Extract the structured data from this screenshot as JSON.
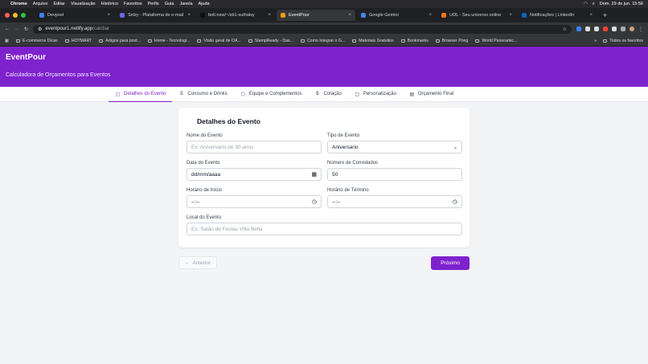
{
  "os_menu": {
    "items": [
      "Chrome",
      "Arquivo",
      "Editar",
      "Visualização",
      "Histórico",
      "Favoritos",
      "Perfis",
      "Guia",
      "Janela",
      "Ajuda"
    ],
    "clock": "Dom. 29 de jun.  15:56"
  },
  "tabs": [
    {
      "label": "Devpost",
      "active": false,
      "color": "#3b82f6"
    },
    {
      "label": "Selzy - Plataforma de e-mail",
      "active": false,
      "color": "#6366f1"
    },
    {
      "label": "bolt.new/~/sb1-suthalsy",
      "active": false,
      "color": "#111111"
    },
    {
      "label": "EventPour",
      "active": true,
      "color": "#f59e0b"
    },
    {
      "label": "Google Gemini",
      "active": false,
      "color": "#4285f4"
    },
    {
      "label": "UOL - Seu universo online",
      "active": false,
      "color": "#f97316"
    },
    {
      "label": "Notificações | LinkedIn",
      "active": false,
      "color": "#0a66c2"
    }
  ],
  "address": {
    "host": "eventpour1.netlify.app",
    "path": "/calcbar"
  },
  "bookmarks": {
    "items": [
      "E-commerce Dicas",
      "HOTMART",
      "Artigos para post...",
      "Home - Tecnologi...",
      "Visão geral de OA...",
      "StampReady - Das...",
      "Como Integrar o G...",
      "Materiais Gratuitos",
      "Bookmarks",
      "Browser Pong",
      "World Panoramic..."
    ],
    "more": "»",
    "all": "Todos os favoritos"
  },
  "app": {
    "title": "EventPour",
    "subtitle": "Calculadora de Orçamentos para Eventos"
  },
  "nav": [
    {
      "label": "Detalhes do Evento",
      "icon": "calendar-icon",
      "glyph": "▢",
      "active": true
    },
    {
      "label": "Consumo e Drinks",
      "icon": "glasses-icon",
      "glyph": "ඹ",
      "active": false
    },
    {
      "label": "Equipe e Complementos",
      "icon": "package-icon",
      "glyph": "⬡",
      "active": false
    },
    {
      "label": "Cotação",
      "icon": "dollar-icon",
      "glyph": "$",
      "active": false
    },
    {
      "label": "Personalização",
      "icon": "palette-icon",
      "glyph": "▢",
      "active": false
    },
    {
      "label": "Orçamento Final",
      "icon": "file-icon",
      "glyph": "▤",
      "active": false
    }
  ],
  "form": {
    "title": "Detalhes do Evento",
    "event_name": {
      "label": "Nome do Evento",
      "placeholder": "Ex: Aniversário de 30 anos"
    },
    "event_type": {
      "label": "Tipo de Evento",
      "value": "Aniversario"
    },
    "event_date": {
      "label": "Data do Evento",
      "value": "dd/mm/aaaa"
    },
    "guests": {
      "label": "Número de Convidados",
      "value": "50"
    },
    "start_time": {
      "label": "Horário de Início",
      "value": "--:--"
    },
    "end_time": {
      "label": "Horário de Término",
      "value": "--:--"
    },
    "location": {
      "label": "Local do Evento",
      "placeholder": "Ex: Salão de Festas Villa Bella"
    }
  },
  "buttons": {
    "prev": "Anterior",
    "prev_arrow": "←",
    "next": "Próximo"
  },
  "colors": {
    "brand": "#7e22ce"
  }
}
